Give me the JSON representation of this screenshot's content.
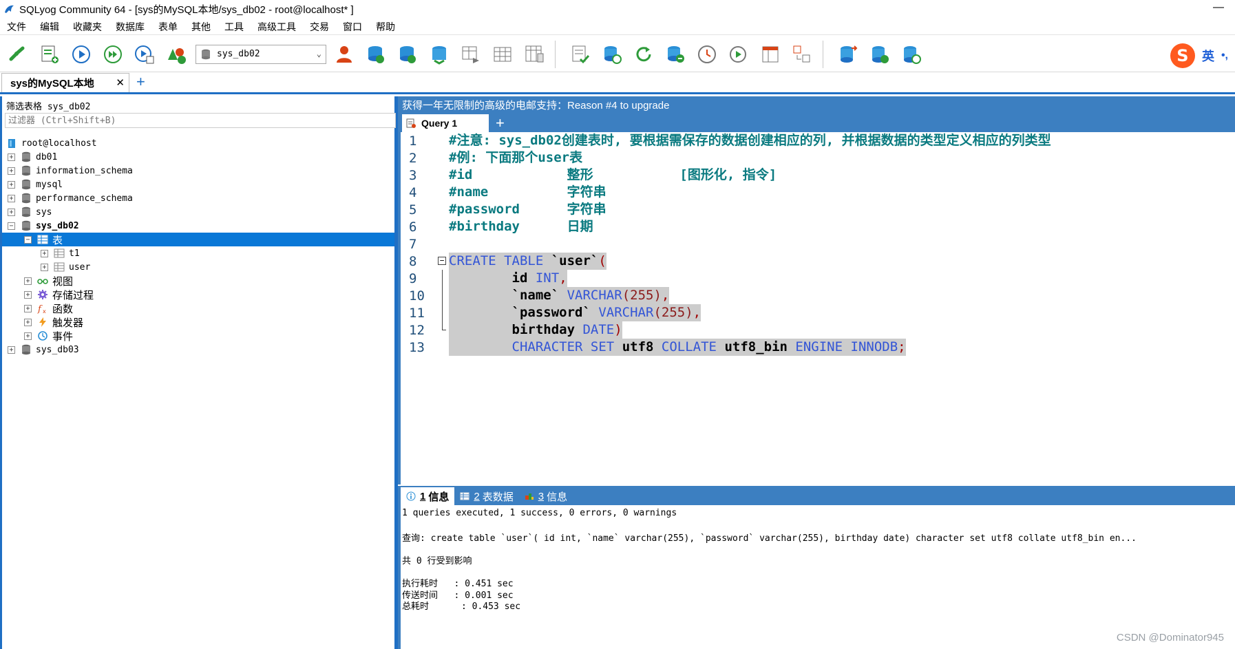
{
  "window": {
    "title": "SQLyog Community 64 - [sys的MySQL本地/sys_db02 - root@localhost* ]",
    "minimize": "—"
  },
  "menu": [
    "文件",
    "编辑",
    "收藏夹",
    "数据库",
    "表单",
    "其他",
    "工具",
    "高级工具",
    "交易",
    "窗口",
    "帮助"
  ],
  "toolbar": {
    "database_select": "sys_db02",
    "ime_logo": "S",
    "ime_lang": "英",
    "ime_punct": "•,"
  },
  "connection_tab": {
    "label": "sys的MySQL本地",
    "close": "✕",
    "add": "+"
  },
  "left_panel": {
    "filter_label": "筛选表格 sys_db02",
    "filter_placeholder": "过滤器 (Ctrl+Shift+B)",
    "tree": {
      "root": "root@localhost",
      "databases": [
        "db01",
        "information_schema",
        "mysql",
        "performance_schema",
        "sys",
        "sys_db02"
      ],
      "tables_folder": "表",
      "tables": [
        "t1",
        "user"
      ],
      "folders": [
        "视图",
        "存储过程",
        "函数",
        "触发器",
        "事件"
      ],
      "last_db": "sys_db03"
    }
  },
  "right_panel": {
    "banner": "获得一年无限制的高级的电邮支持：Reason #4 to upgrade",
    "query_tab": "Query 1",
    "query_add": "+",
    "editor": {
      "line_numbers": [
        "1",
        "2",
        "3",
        "4",
        "5",
        "6",
        "7",
        "8",
        "9",
        "10",
        "11",
        "12",
        "13"
      ],
      "comments": [
        "#注意: sys_db02创建表时, 要根据需保存的数据创建相应的列, 并根据数据的类型定义相应的列类型",
        "#例: 下面那个user表",
        "#id            整形           [图形化, 指令]",
        "#name          字符串",
        "#password      字符串",
        "#birthday      日期"
      ],
      "code": {
        "l8_kw": "CREATE TABLE",
        "l8_name": " `user`",
        "l8_paren": "(",
        "l9_col": "id",
        "l9_type": "INT",
        "l10_col": "`name`",
        "l10_type": "VARCHAR",
        "l10_arg": "(255)",
        "l11_col": "`password`",
        "l11_type": "VARCHAR",
        "l11_arg": "(255)",
        "l12_col": "birthday",
        "l12_type": "DATE",
        "l12_close": ")",
        "l13_kw1": "CHARACTER SET",
        "l13_v1": "utf8",
        "l13_kw2": "COLLATE",
        "l13_v2": "utf8_bin",
        "l13_kw3": "ENGINE",
        "l13_kw4": "INNODB",
        "l13_end": ";"
      }
    },
    "result_tabs": [
      {
        "num": "1",
        "label": "信息"
      },
      {
        "num": "2",
        "label": "表数据"
      },
      {
        "num": "3",
        "label": "信息"
      }
    ],
    "messages": {
      "summary": "1 queries executed, 1 success, 0 errors, 0 warnings",
      "query": "查询: create table `user`( id int, `name` varchar(255), `password` varchar(255), birthday date) character set utf8 collate utf8_bin en...",
      "affected": "共 0 行受到影响",
      "exec_time": "执行耗时   : 0.451 sec",
      "transfer_time": "传送时间   : 0.001 sec",
      "total_time": "总耗时      : 0.453 sec"
    }
  },
  "watermark": "CSDN @Dominator945",
  "colors": {
    "accent_blue": "#1f6fc4",
    "banner_blue": "#3c7fc1",
    "selection": "#0a78d7",
    "comment_teal": "#0a7a80",
    "keyword_blue": "#3355d6"
  }
}
